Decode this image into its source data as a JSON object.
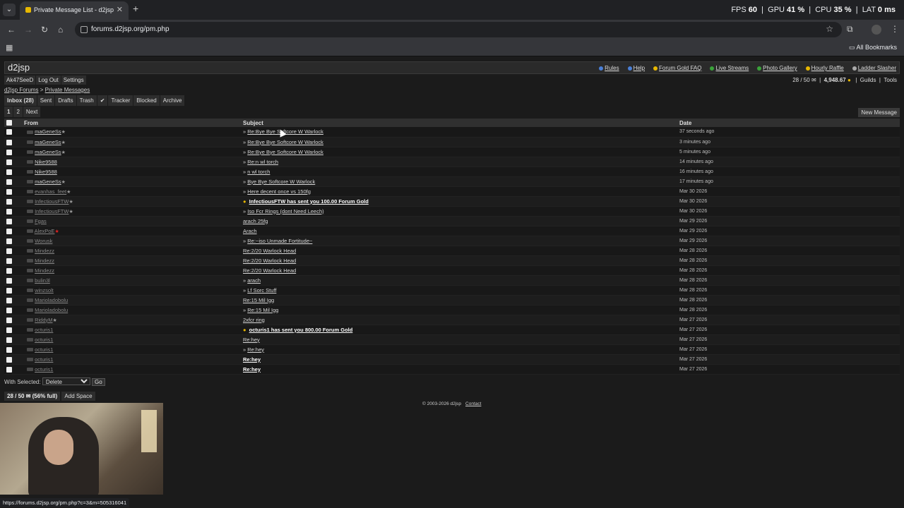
{
  "browser": {
    "tab_title": "Private Message List - d2jsp",
    "new_tab": "+",
    "close": "✕",
    "url": "forums.d2jsp.org/pm.php",
    "all_bookmarks": "All Bookmarks",
    "perf": {
      "fps_label": "FPS",
      "fps": "60",
      "gpu_label": "GPU",
      "gpu": "41 %",
      "cpu_label": "CPU",
      "cpu": "35 %",
      "lat_label": "LAT",
      "lat": "0 ms"
    },
    "status_url": "https://forums.d2jsp.org/pm.php?c=3&m=505316041"
  },
  "site": {
    "logo": "d2jsp",
    "top_links": [
      {
        "label": "Rules",
        "color": "#4a7fd6"
      },
      {
        "label": "Help",
        "color": "#4a7fd6"
      },
      {
        "label": "Forum Gold FAQ",
        "color": "#e8b800"
      },
      {
        "label": "Live Streams",
        "color": "#3aa33a"
      },
      {
        "label": "Photo Gallery",
        "color": "#3aa33a"
      },
      {
        "label": "Hourly Raffle",
        "color": "#e8b800"
      },
      {
        "label": "Ladder Slasher",
        "color": "#aaaaaa"
      }
    ],
    "user": {
      "name": "Ak47SeeD",
      "logout": "Log Out",
      "settings": "Settings",
      "pm_count": "28 / 50",
      "gold": "4,948.67",
      "guilds": "Guilds",
      "tools": "Tools"
    },
    "breadcrumb": {
      "forums": "d2jsp Forums",
      "sep": ">",
      "pm": "Private Messages"
    },
    "tabs": [
      {
        "label": "Inbox (28)",
        "active": true
      },
      {
        "label": "Sent"
      },
      {
        "label": "Drafts"
      },
      {
        "label": "Trash"
      },
      {
        "label": "✔"
      },
      {
        "label": "Tracker"
      },
      {
        "label": "Blocked"
      },
      {
        "label": "Archive"
      }
    ],
    "pages": [
      "1",
      "2",
      "Next"
    ],
    "new_message": "New Message",
    "columns": {
      "from": "From",
      "subject": "Subject",
      "date": "Date"
    },
    "messages": [
      {
        "from": "maGeneSs",
        "star": "★",
        "subject": "Re:Bye Bye Softcore W Warlock",
        "prefix": "»",
        "date": "37 seconds ago"
      },
      {
        "from": "maGeneSs",
        "star": "★",
        "subject": "Re:Bye Bye Softcore W Warlock",
        "prefix": "»",
        "date": "3 minutes ago"
      },
      {
        "from": "maGeneSs",
        "star": "★",
        "subject": "Re:Bye Bye Softcore W Warlock",
        "prefix": "»",
        "date": "5 minutes ago"
      },
      {
        "from": "Nike9588",
        "star": "",
        "subject": "Re:n wl torch",
        "prefix": "»",
        "date": "14 minutes ago"
      },
      {
        "from": "Nike9588",
        "star": "",
        "subject": "n wl torch",
        "prefix": "»",
        "date": "16 minutes ago"
      },
      {
        "from": "maGeneSs",
        "star": "★",
        "subject": "Bye Bye Softcore W Warlock",
        "prefix": "»",
        "date": "17 minutes ago"
      },
      {
        "from": "evanhas_feet",
        "star": "★",
        "subject": "Here decent once vs 150fg",
        "prefix": "»",
        "date": "Mar 30 2026",
        "read": true
      },
      {
        "from": "InfectiousFTW",
        "star": "★",
        "subject": "InfectiousFTW has sent you 100.00 Forum Gold",
        "prefix": "",
        "gold": true,
        "date": "Mar 30 2026",
        "read": true
      },
      {
        "from": "InfectiousFTW",
        "star": "★",
        "subject": "Iso Fcr Rings (dont Need Leech)",
        "prefix": "»",
        "date": "Mar 30 2026",
        "read": true
      },
      {
        "from": "Fgas",
        "star": "",
        "subject": "arach 25fg",
        "prefix": "",
        "date": "Mar 29 2026",
        "read": true
      },
      {
        "from": "AlexPoE",
        "star": "★",
        "starRed": true,
        "subject": "Arach",
        "prefix": "",
        "date": "Mar 29 2026",
        "read": true
      },
      {
        "from": "Worusk",
        "star": "",
        "subject": "Re:~iso Unmade Fortitude~",
        "prefix": "»",
        "date": "Mar 29 2026",
        "read": true
      },
      {
        "from": "Mindezz",
        "star": "",
        "subject": "Re:2/20 Warlock Head",
        "prefix": "",
        "date": "Mar 28 2026",
        "read": true
      },
      {
        "from": "Mindezz",
        "star": "",
        "subject": "Re:2/20 Warlock Head",
        "prefix": "",
        "date": "Mar 28 2026",
        "read": true
      },
      {
        "from": "Mindezz",
        "star": "",
        "subject": "Re:2/20 Warlock Head",
        "prefix": "",
        "date": "Mar 28 2026",
        "read": true
      },
      {
        "from": "bulin3l",
        "star": "",
        "subject": "arach",
        "prefix": "»",
        "date": "Mar 28 2026",
        "read": true
      },
      {
        "from": "winzsolt",
        "star": "",
        "subject": "Lf Sorc Stuff",
        "prefix": "»",
        "date": "Mar 28 2026",
        "read": true
      },
      {
        "from": "Marioladobolu",
        "star": "",
        "subject": "Re:15 Mil Igg",
        "prefix": "",
        "date": "Mar 28 2026",
        "read": true
      },
      {
        "from": "Marioladobolu",
        "star": "",
        "subject": "Re:15 Mil Igg",
        "prefix": "»",
        "date": "Mar 28 2026",
        "read": true
      },
      {
        "from": "RiddyM",
        "star": "★",
        "subject": "2xfcr ring",
        "prefix": "",
        "date": "Mar 27 2026",
        "read": true
      },
      {
        "from": "octuris1",
        "star": "",
        "subject": "octuris1 has sent you 800.00 Forum Gold",
        "prefix": "",
        "gold": true,
        "date": "Mar 27 2026",
        "read": true
      },
      {
        "from": "octuris1",
        "star": "",
        "subject": "Re:hey",
        "prefix": "",
        "date": "Mar 27 2026",
        "read": true
      },
      {
        "from": "octuris1",
        "star": "",
        "subject": "Re:hey",
        "prefix": "»",
        "date": "Mar 27 2026",
        "read": true
      },
      {
        "from": "octuris1",
        "star": "",
        "subject": "Re:hey",
        "prefix": "",
        "bold": true,
        "date": "Mar 27 2026",
        "read": true
      },
      {
        "from": "octuris1",
        "star": "",
        "subject": "Re:hey",
        "prefix": "",
        "bold": true,
        "date": "Mar 27 2026",
        "read": true
      }
    ],
    "with_selected": "With Selected:",
    "action_selected": "Delete",
    "go": "Go",
    "quota": "28 / 50 ✉ (56% full)",
    "add_space": "Add Space",
    "copyright": "© 2003-2026 d2jsp",
    "contact": "Contact"
  }
}
